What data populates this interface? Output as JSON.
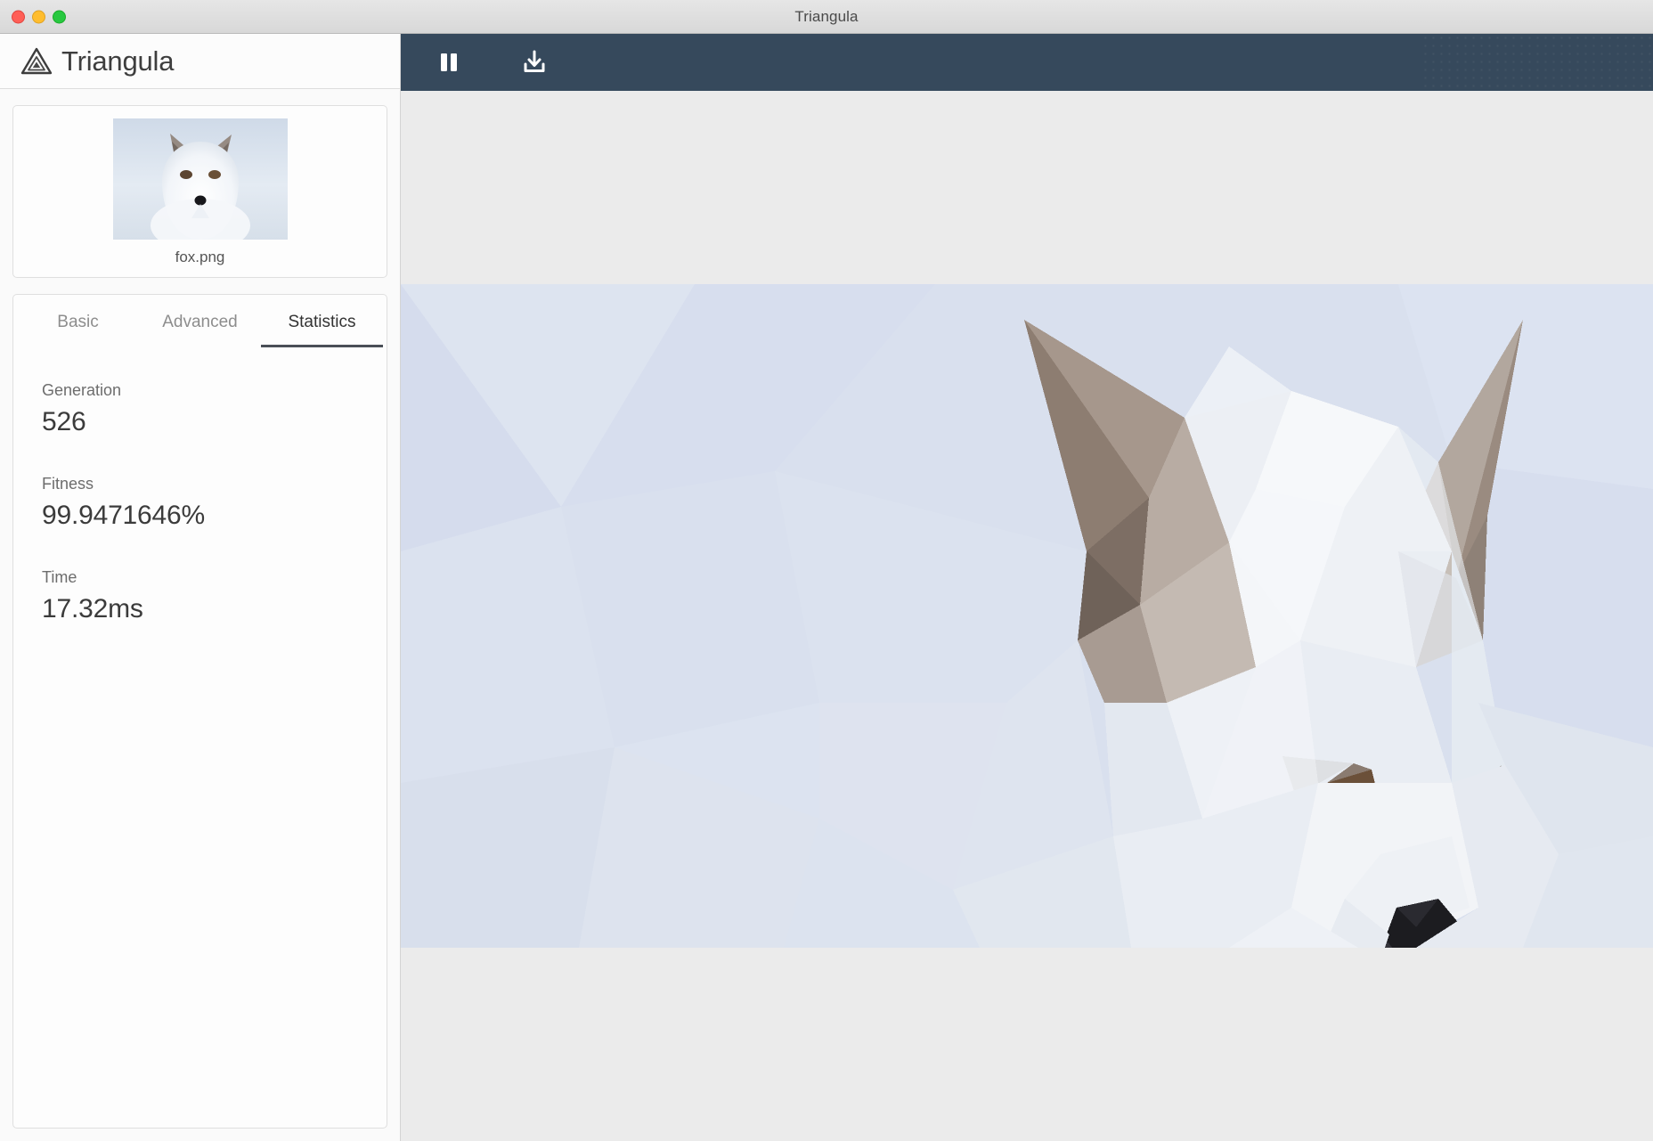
{
  "window": {
    "title": "Triangula",
    "traffic_lights": [
      "close-button",
      "minimize-button",
      "maximize-button"
    ]
  },
  "sidebar": {
    "brand": {
      "name": "Triangula",
      "logo_icon": "triangle-logo-icon"
    },
    "source_image": {
      "filename": "fox.png",
      "alt": "arctic fox photo thumbnail"
    },
    "tabs": [
      {
        "label": "Basic",
        "active": false
      },
      {
        "label": "Advanced",
        "active": false
      },
      {
        "label": "Statistics",
        "active": true
      }
    ],
    "statistics": [
      {
        "label": "Generation",
        "value": "526"
      },
      {
        "label": "Fitness",
        "value": "99.9471646%"
      },
      {
        "label": "Time",
        "value": "17.32ms"
      }
    ]
  },
  "toolbar": {
    "background": "#36495c",
    "buttons": [
      {
        "name": "pause-button",
        "icon": "pause-icon",
        "label": "Pause"
      },
      {
        "name": "save-button",
        "icon": "download-icon",
        "label": "Save"
      }
    ]
  },
  "canvas": {
    "name": "triangulation-render",
    "background": "#d9e0ee",
    "subject": "low-poly arctic fox",
    "palette": {
      "canvas_bg": "#d9e0ee",
      "snow_light": "#f3f5f8",
      "snow_white": "#fbfcfd",
      "fur_shadow": "#d2d8e0",
      "fur_gray": "#c3c8cf",
      "ear_brown": "#8e7f74",
      "ear_dark": "#6e6159",
      "eye_brown": "#6b4f3a",
      "eye_dark": "#463830",
      "nose_dark": "#1d1d21"
    }
  }
}
